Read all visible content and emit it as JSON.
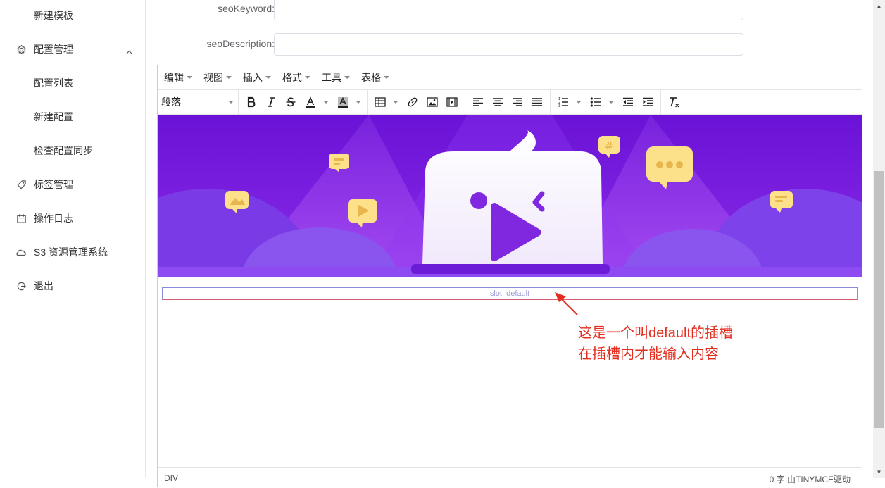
{
  "sidebar": {
    "items": [
      {
        "label": "新建模板",
        "icon": "none"
      },
      {
        "label": "配置管理",
        "icon": "gear-icon"
      },
      {
        "label": "配置列表",
        "icon": "none"
      },
      {
        "label": "新建配置",
        "icon": "none"
      },
      {
        "label": "检查配置同步",
        "icon": "none"
      },
      {
        "label": "标签管理",
        "icon": "tag-icon"
      },
      {
        "label": "操作日志",
        "icon": "calendar-icon"
      },
      {
        "label": "S3 资源管理系统",
        "icon": "cloud-icon"
      },
      {
        "label": "退出",
        "icon": "logout-icon"
      }
    ]
  },
  "form": {
    "seo_keyword_label": "seoKeyword:",
    "seo_keyword_value": "",
    "seo_description_label": "seoDescription:",
    "seo_description_value": ""
  },
  "editor": {
    "menus": [
      "编辑",
      "视图",
      "插入",
      "格式",
      "工具",
      "表格"
    ],
    "block_format": "段落",
    "slot_text": "slot: default",
    "status_path": "DIV",
    "status_brand": "0 字 由TINYMCE驱动"
  },
  "annotation": {
    "line1": "这是一个叫default的插槽",
    "line2": "在插槽内才能输入内容"
  },
  "colors": {
    "banner_purple": "#6a12d6",
    "accent_red": "#e32d1f",
    "bubble_yellow": "#fde18a"
  }
}
